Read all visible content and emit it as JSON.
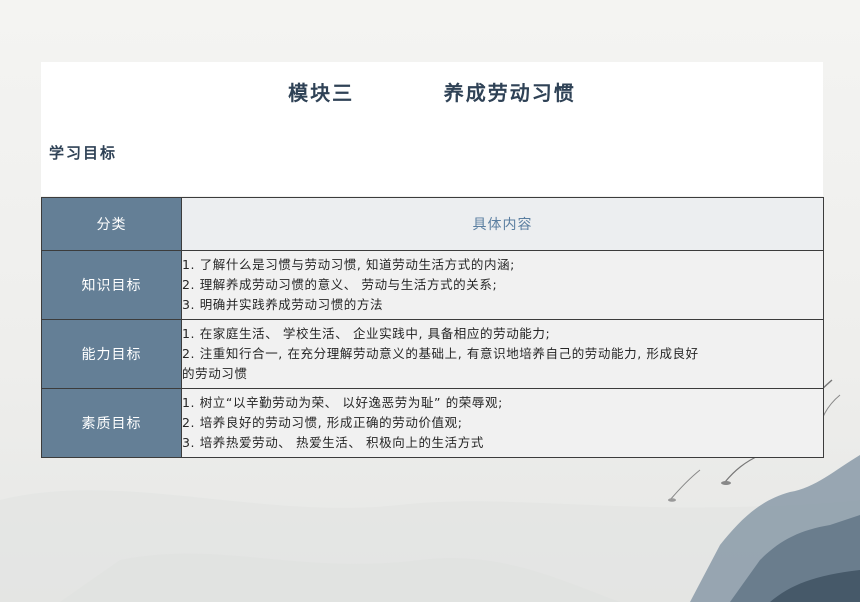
{
  "slide": {
    "title": "模块三          养成劳动习惯",
    "subtitle": "学习目标"
  },
  "table": {
    "headers": [
      "分类",
      "具体内容"
    ],
    "rows": [
      {
        "category": "知识目标",
        "items": [
          "1. 了解什么是习惯与劳动习惯, 知道劳动生活方式的内涵;",
          "2. 理解养成劳动习惯的意义、 劳动与生活方式的关系;",
          "3. 明确并实践养成劳动习惯的方法"
        ]
      },
      {
        "category": "能力目标",
        "items": [
          "1. 在家庭生活、 学校生活、 企业实践中, 具备相应的劳动能力;",
          "2. 注重知行合一, 在充分理解劳动意义的基础上, 有意识地培养自己的劳动能力, 形成良好",
          "的劳动习惯"
        ]
      },
      {
        "category": "素质目标",
        "items": [
          "1. 树立“以辛勤劳动为荣、 以好逸恶劳为耻” 的荣辱观;",
          "2. 培养良好的劳动习惯, 形成正确的劳动价值观;",
          "3. 培养热爱劳动、 热爱生活、 积极向上的生活方式"
        ]
      }
    ]
  },
  "colors": {
    "category_fill": "#647f96",
    "content_fill": "#f1f1f1",
    "header_text": "#5a7ea0",
    "title_text": "#2f4256"
  }
}
